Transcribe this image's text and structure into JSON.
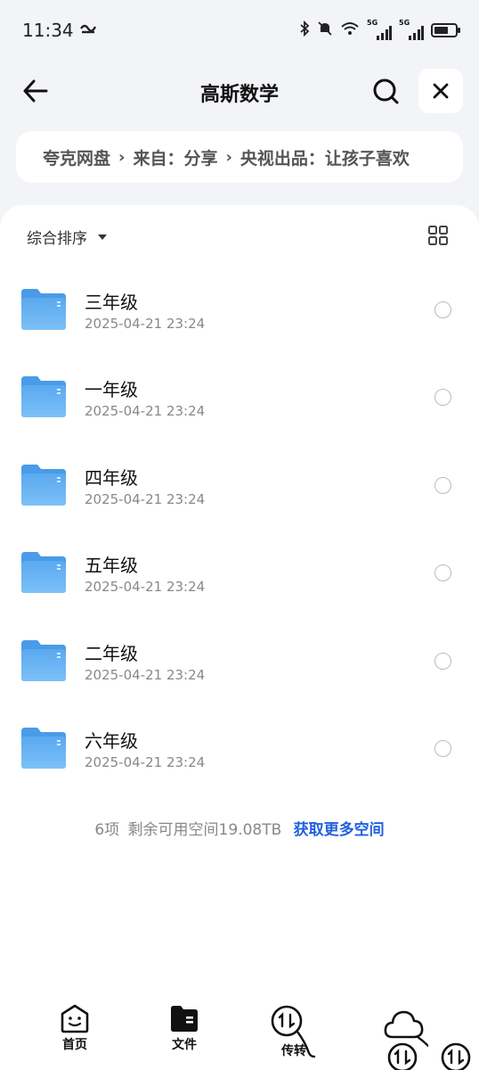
{
  "status_bar": {
    "time": "11:34",
    "network_label_1": "5G",
    "network_label_2": "5G",
    "battery_level": 0.7
  },
  "header": {
    "title": "高斯数学",
    "back_icon": "back-arrow-icon",
    "search_icon": "search-icon",
    "close_icon": "close-icon"
  },
  "breadcrumb": {
    "items": [
      "夸克网盘",
      "来自：分享",
      "央视出品：让孩子喜欢"
    ]
  },
  "toolbar": {
    "sort_label": "综合排序",
    "view_toggle_icon": "grid-view-icon"
  },
  "files": [
    {
      "name": "三年级",
      "date": "2025-04-21 23:24"
    },
    {
      "name": "一年级",
      "date": "2025-04-21 23:24"
    },
    {
      "name": "四年级",
      "date": "2025-04-21 23:24"
    },
    {
      "name": "五年级",
      "date": "2025-04-21 23:24"
    },
    {
      "name": "二年级",
      "date": "2025-04-21 23:24"
    },
    {
      "name": "六年级",
      "date": "2025-04-21 23:24"
    }
  ],
  "footer": {
    "count": "6项",
    "space": "剩余可用空间19.08TB",
    "more_space_link": "获取更多空间"
  },
  "bottom_nav": {
    "items": [
      {
        "label": "首页",
        "icon": "home-face-icon"
      },
      {
        "label": "文件",
        "icon": "folder-file-icon"
      },
      {
        "label": "传转",
        "icon": "transfer-icon"
      },
      {
        "label": "",
        "icon": "cloud-icon"
      }
    ],
    "floating_icons": [
      "transfer-badge-icon",
      "transfer-badge-icon"
    ]
  },
  "colors": {
    "background": "#f3f4f7",
    "accent_link": "#2160e0",
    "folder": "#5aa9f0"
  }
}
